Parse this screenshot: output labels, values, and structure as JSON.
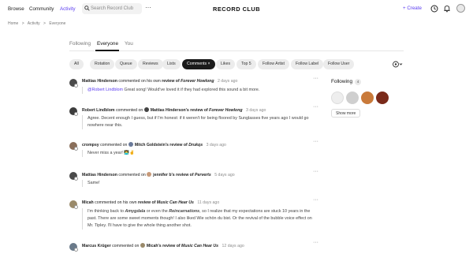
{
  "nav": {
    "browse": "Browse",
    "community": "Community",
    "activity": "Activity",
    "search_placeholder": "Search Record Club",
    "more": "···",
    "logo": "RECORD CLUB",
    "create": "+ Create"
  },
  "breadcrumb": [
    "Home",
    ">",
    "Activity",
    ">",
    "Everyone"
  ],
  "tabs": [
    "Following",
    "Everyone",
    "You"
  ],
  "chips": [
    "All",
    "Rotation",
    "Queue",
    "Reviews",
    "Lists",
    "Comments ×",
    "Likes",
    "Top 5",
    "Follow Artist",
    "Follow Label",
    "Follow User"
  ],
  "active_chip": "Comments",
  "accent_color": "#5b3cf0",
  "feed": [
    {
      "user": "Mattias Hinderson",
      "verb": " commented on his own ",
      "target_user": "",
      "target_label": "review of ",
      "album": "Forever Howlong",
      "time": "2 days ago",
      "mention": "@Robert Lindblom",
      "comment": " Great song! Would've loved it if they had explored this sound a bit more."
    },
    {
      "user": "Robert Lindblom",
      "verb": " commented on ",
      "target_user": "Mattias Hinderson's",
      "target_label": " review of ",
      "album": "Forever Howlong",
      "time": "3 days ago",
      "mention": "",
      "comment": "Agree. Decent enough I guess, but if I'm honest: if it weren't for being floored by Sunglasses five years ago I would go nowhere near this."
    },
    {
      "user": "crompsy",
      "verb": " commented on ",
      "target_user": "Mitch Goldstein's",
      "target_label": " review of ",
      "album": "Drukqs",
      "time": "3 days ago",
      "mention": "",
      "comment": "Never miss a year! 👨‍💻✌️"
    },
    {
      "user": "Mattias Hinderson",
      "verb": " commented on ",
      "target_user": "jennifer b's",
      "target_label": " review of ",
      "album": "Perverts",
      "time": "5 days ago",
      "mention": "",
      "comment": "Same!"
    },
    {
      "user": "Micah",
      "verb": " commented on his own ",
      "target_user": "",
      "target_label": "review of ",
      "album": "Music Can Hear Us",
      "time": "11 days ago",
      "mention": "",
      "comment_parts": [
        "I'm thinking back to ",
        "Amygdala",
        " or even the ",
        "Reincarnations",
        ", so I realize that my expectations are stuck 10 years in the past. There are some sweet moments though! I also liked Wie schön du bist. Or the revival of the bubble voice effect on Mr. Tipley. I'll have to give the whole thing another shot."
      ]
    },
    {
      "user": "Marcus Krüger",
      "verb": " commented on ",
      "target_user": "Micah's",
      "target_label": " review of ",
      "album": "Music Can Hear Us",
      "time": "12 days ago",
      "mention": "",
      "comment": ""
    }
  ],
  "following": {
    "title": "Following",
    "count": "4",
    "show_more": "Show more"
  }
}
